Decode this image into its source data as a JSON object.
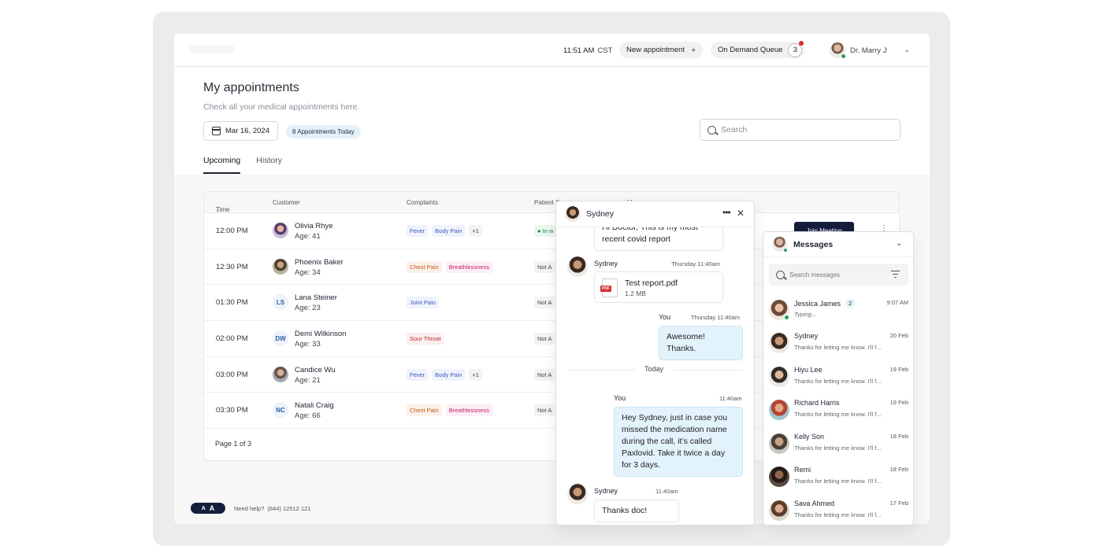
{
  "topbar": {
    "time": "11:51 AM",
    "timezone": "CST",
    "new_appointment_label": "New appointment",
    "new_appointment_icon": "+",
    "queue_label": "On Demand Queue",
    "queue_count": "3",
    "doctor_name": "Dr. Marry J",
    "chevron": "⌄"
  },
  "header": {
    "title": "My appointments",
    "subtitle": "Check all your medical appointments here.",
    "date": "Mar 16, 2024",
    "today_badge": "8 Appointments Today",
    "search_placeholder": "Search"
  },
  "tabs": [
    {
      "label": "Upcoming",
      "active": true
    },
    {
      "label": "History",
      "active": false
    }
  ],
  "table": {
    "columns": {
      "time": "Time",
      "sort_icon": "↓",
      "customer": "Customer",
      "complaints": "Complaints",
      "status": "Patient S",
      "action": "M"
    },
    "rows": [
      {
        "time": "12:00 PM",
        "name": "Olivia Rhye",
        "age": "Age: 41",
        "initials": "",
        "tags": [
          "Fever",
          "Body Pain",
          "+1"
        ],
        "status": "● In w"
      },
      {
        "time": "12:30 PM",
        "name": "Phoenix Baker",
        "age": "Age: 34",
        "initials": "",
        "tags": [
          "Chest Pain",
          "Breathlessness"
        ],
        "status": "Not A"
      },
      {
        "time": "01:30 PM",
        "name": "Lana Steiner",
        "age": "Age: 23",
        "initials": "LS",
        "tags": [
          "Joint Pain"
        ],
        "status": "Not A"
      },
      {
        "time": "02:00 PM",
        "name": "Demi Wilkinson",
        "age": "Age: 33",
        "initials": "DW",
        "tags": [
          "Sour Throat"
        ],
        "status": "Not A"
      },
      {
        "time": "03:00 PM",
        "name": "Candice Wu",
        "age": "Age: 21",
        "initials": "",
        "tags": [
          "Fever",
          "Body Pain",
          "+1"
        ],
        "status": "Not A"
      },
      {
        "time": "03:30 PM",
        "name": "Natali Craig",
        "age": "Age: 66",
        "initials": "NC",
        "tags": [
          "Chest Pain",
          "Breathlessness"
        ],
        "status": "Not A"
      }
    ],
    "join_label": "Join Meeting",
    "kebab": "⋮",
    "pagination": "Page 1 of 3"
  },
  "footer": {
    "font_small": "A",
    "font_large": "A",
    "help_label": "Need help?",
    "phone": "(844) 12512 121"
  },
  "chat": {
    "contact": "Sydney",
    "more_icon": "•••",
    "close_icon": "✕",
    "msg1_text": "Hi Doctor, This is my most recent covid report",
    "msg2_name": "Sydney",
    "msg2_time": "Thursday 11:40am",
    "file_name": "Test report.pdf",
    "file_size": "1.2 MB",
    "file_badge": "PDF",
    "msg3_name": "You",
    "msg3_time": "Thursday 11:40am",
    "msg3_text": "Awesome! Thanks.",
    "divider": "Today",
    "msg4_name": "You",
    "msg4_time": "11:40am",
    "msg4_text": "Hey Sydney, just in case you missed the medication name during the call, it’s called Paxlovid. Take it twice a day for 3 days.",
    "msg5_name": "Sydney",
    "msg5_time": "11:40am",
    "msg5_text": "Thanks doc!"
  },
  "messages": {
    "title": "Messages",
    "chevron": "⌄",
    "search_placeholder": "Search messages",
    "conversations": [
      {
        "name": "Jessica James",
        "unread": "2",
        "time": "9:07 AM",
        "preview": "Typing..."
      },
      {
        "name": "Sydney",
        "time": "20 Feb",
        "preview": "Thanks for letting me know. I'll f..."
      },
      {
        "name": "Hiyu Lee",
        "time": "19 Feb",
        "preview": "Thanks for letting me know. I'll f..."
      },
      {
        "name": "Richard Harris",
        "time": "19 Feb",
        "preview": "Thanks for letting me know. I'll f..."
      },
      {
        "name": "Kelly Son",
        "time": "18 Feb",
        "preview": "Thanks for letting me know. I'll f..."
      },
      {
        "name": "Remi",
        "time": "18 Feb",
        "preview": "Thanks for letting me know. I'll f..."
      },
      {
        "name": "Sava Ahmed",
        "time": "17 Feb",
        "preview": "Thanks for letting me know. I'll f..."
      }
    ]
  },
  "colors": {
    "primary": "#141e3c",
    "accent": "#e3f3fb",
    "online": "#22a35a",
    "alert": "#e02828"
  }
}
